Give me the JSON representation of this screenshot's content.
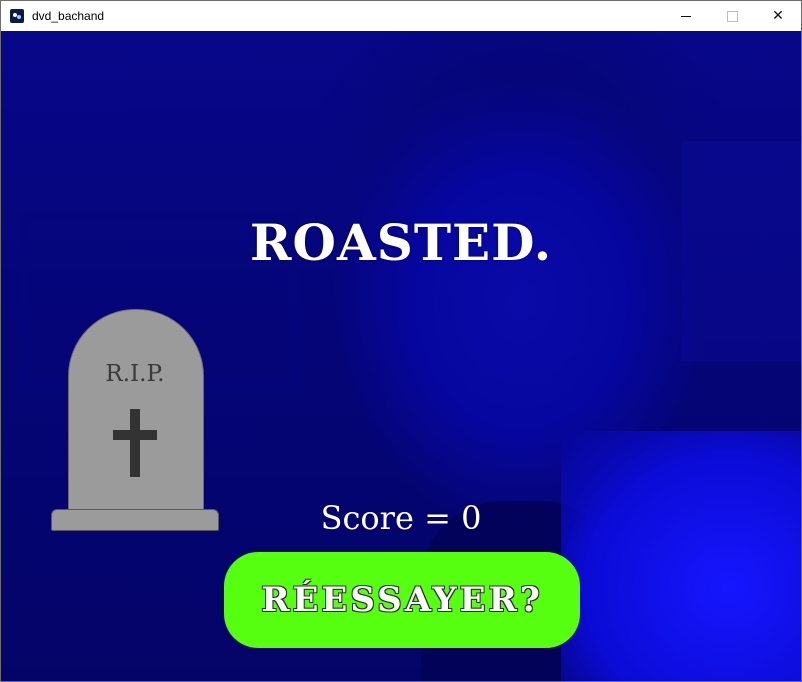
{
  "window": {
    "title": "dvd_bachand",
    "app_icon": "app-icon",
    "controls": {
      "minimize_icon": "minimize-icon",
      "maximize_icon": "maximize-icon",
      "close_label": "✕"
    }
  },
  "game_over": {
    "headline": "ROASTED.",
    "tombstone": {
      "inscription": "R.I.P.",
      "icon": "cross-icon"
    },
    "score_text": "Score = 0",
    "retry_label": "RÉESSAYER?"
  },
  "colors": {
    "background": "#0606a0",
    "retry_button": "#55ff0f",
    "tombstone": "#9b9b9b",
    "headline_text": "#ffffff"
  }
}
